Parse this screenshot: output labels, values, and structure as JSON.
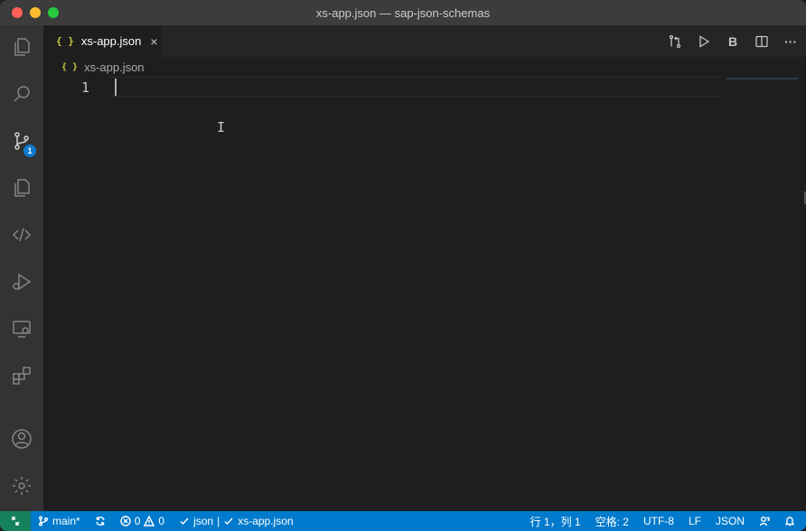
{
  "window": {
    "title": "xs-app.json — sap-json-schemas"
  },
  "activity_bar": {
    "source_control_badge": "1"
  },
  "tabs": [
    {
      "icon": "{ }",
      "label": "xs-app.json",
      "close": "×"
    }
  ],
  "editor_actions": {
    "bold_label": "B",
    "more_label": "···"
  },
  "breadcrumb": {
    "icon": "{ }",
    "file": "xs-app.json"
  },
  "editor": {
    "line_numbers": [
      "1"
    ]
  },
  "status_bar": {
    "branch": "main*",
    "errors": "0",
    "warnings": "0",
    "json_check": "json",
    "separator": "|",
    "file_check": "xs-app.json",
    "position": "行 1，列 1",
    "spaces": "空格: 2",
    "encoding": "UTF-8",
    "eol": "LF",
    "language": "JSON"
  },
  "colors": {
    "status_bar": "#007acc",
    "remote": "#16825d",
    "badge": "#0e79cc",
    "json_icon": "#cbcb41"
  }
}
